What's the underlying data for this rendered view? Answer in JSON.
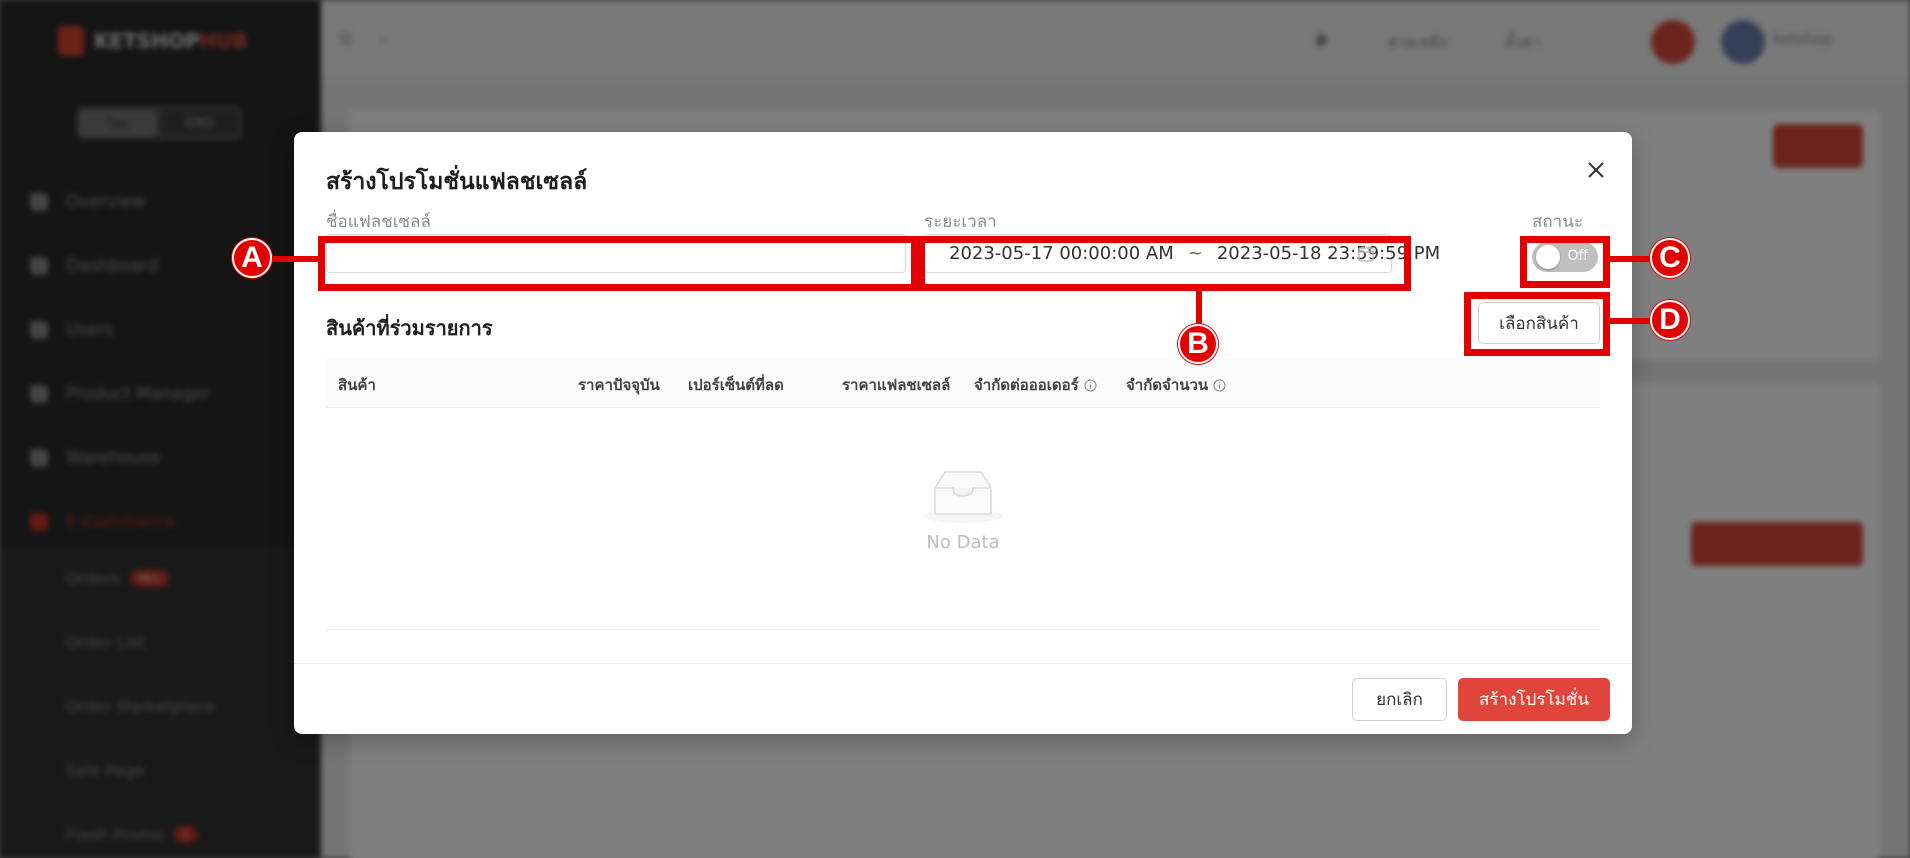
{
  "background": {
    "logo_text": "KETSHOP",
    "logo_accent": "HUB",
    "lang_options": [
      "ไทย",
      "ENG"
    ],
    "nav_items": [
      "Overview",
      "Dashboard",
      "Users",
      "Product Manager",
      "Warehouse",
      "E-Commerce"
    ],
    "sub_items": [
      {
        "label": "Orders",
        "badge": "99+"
      },
      {
        "label": "Order List",
        "badge": ""
      },
      {
        "label": "Order Marketplace",
        "badge": ""
      },
      {
        "label": "Sale Page",
        "badge": ""
      },
      {
        "label": "Flash Promo",
        "badge": "1"
      }
    ],
    "topbar": {
      "item1": "ช่วยเหลือ",
      "item2": "ตั้งค่า",
      "user": "ketshop"
    }
  },
  "modal": {
    "title": "สร้างโปรโมชั่นแฟลชเซลล์",
    "name_label": "ชื่อแฟลชเซลล์",
    "name_value": "",
    "period_label": "ระยะเวลา",
    "start_datetime": "2023-05-17 00:00:00 AM",
    "range_separator": "~",
    "end_datetime": "2023-05-18 23:59:59 PM",
    "status_label": "สถานะ",
    "status_value": "Off",
    "products_title": "สินค้าที่ร่วมรายการ",
    "select_products_button": "เลือกสินค้า",
    "columns": [
      "สินค้า",
      "ราคาปัจจุบัน",
      "เปอร์เซ็นต์ที่ลด",
      "ราคาแฟลชเซลล์",
      "จำกัดต่อออเดอร์",
      "จำกัดจำนวน"
    ],
    "empty_text": "No Data",
    "cancel_button": "ยกเลิก",
    "create_button": "สร้างโปรโมชั่น"
  },
  "annotations": {
    "a": "A",
    "b": "B",
    "c": "C",
    "d": "D"
  },
  "colors": {
    "annotation": "#e30000",
    "primary": "#e0443a",
    "toggle_off": "#bfbfbf"
  }
}
